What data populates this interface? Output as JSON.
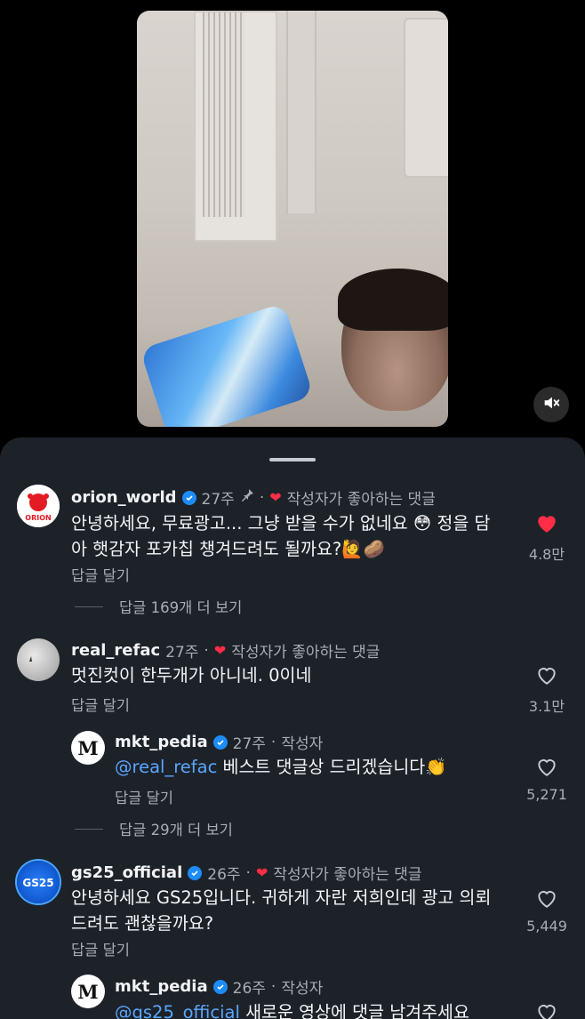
{
  "video": {
    "mute_icon": "speaker-muted-icon"
  },
  "comments": [
    {
      "username": "orion_world",
      "time": "27주",
      "pinned_icon": "pin-icon",
      "liked_by_author": "작성자가 좋아하는 댓글",
      "text": "안녕하세요, 무료광고... 그냥 받을 수가 없네요 😳 정을 담아 햇감자 포카칩 챙겨드려도 될까요?🙋🥔",
      "line1": "안녕하세요, 무료광고... 그냥 받을 수가 없네요 😳 정을 담",
      "line2": "아 햇감자 포카칩 챙겨드려도 될까요?🙋🥔",
      "reply_label": "답글 달기",
      "likes": "4.8만",
      "liked": true,
      "more_replies": "답글 169개 더 보기",
      "avatar_label": "ORION",
      "avatar_color": "#e31b23"
    },
    {
      "username": "real_refac",
      "time": "27주",
      "liked_by_author": "작성자가 좋아하는 댓글",
      "text": "멋진컷이 한두개가 아니네. 0이네",
      "reply_label": "답글 달기",
      "likes": "3.1만",
      "liked": false,
      "replies": [
        {
          "username": "mkt_pedia",
          "time": "27주",
          "author_tag": "작성자",
          "mention": "@real_refac",
          "text": " 베스트 댓글상 드리겠습니다👏",
          "reply_label": "답글 달기",
          "likes": "5,271",
          "avatar_label": "M"
        }
      ],
      "more_replies": "답글 29개 더 보기"
    },
    {
      "username": "gs25_official",
      "time": "26주",
      "liked_by_author": "작성자가 좋아하는 댓글",
      "line1": "안녕하세요 GS25입니다. 귀하게 자란 저희인데 광고 의뢰",
      "line2": "드려도 괜찮을까요?",
      "reply_label": "답글 달기",
      "likes": "5,449",
      "liked": false,
      "avatar_label": "GS25",
      "replies": [
        {
          "username": "mkt_pedia",
          "time": "26주",
          "author_tag": "작성자",
          "mention": "@gs25_official",
          "text": " 새로운 영상에 댓글 남겨주세요",
          "avatar_label": "M"
        }
      ]
    }
  ],
  "colors": {
    "sheet_bg": "#1d2229",
    "accent_blue": "#1d8cf8",
    "heart_red": "#ff2d45",
    "mention_blue": "#5aa6ff"
  }
}
